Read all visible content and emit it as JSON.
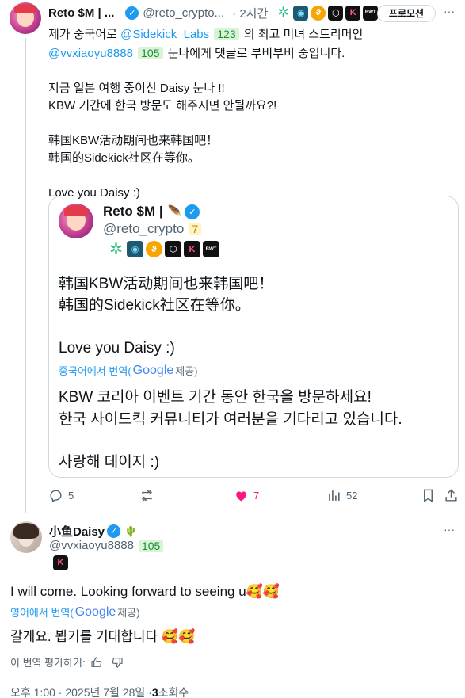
{
  "main_tweet": {
    "display_name": "Reto $M | ...",
    "handle": "@reto_crypto...",
    "time": "· 2시간",
    "promo_button": "프로모션",
    "more": "···",
    "line1_pre": "제가 중국어로 ",
    "mention1": "@Sidekick_Labs",
    "mention1_count": "123",
    "line1_post": " 의 최고 미녀 스트리머인",
    "mention2": "@vvxiaoyu8888",
    "mention2_count": "105",
    "line2_post": " 눈나에게 댓글로 부비부비 중입니다.",
    "line3": "지금 일본 여행 중이신 Daisy 눈나 !!",
    "line4": "KBW 기간에 한국 방문도 해주시면 안될까요?!",
    "line5": "韩国KBW活动期间也来韩国吧！",
    "line6": "韩国的Sidekick社区在等你。",
    "line7": "Love you Daisy :)"
  },
  "quoted_tweet": {
    "display_name": "Reto $M |",
    "handle": "@reto_crypto",
    "handle_count": "7",
    "body1": "韩国KBW活动期间也来韩国吧！",
    "body2": "韩国的Sidekick社区在等你。",
    "body3": "Love you Daisy :)",
    "translate_label": "중국어에서 번역(",
    "google": "Google",
    "provided": " 제공)",
    "trans1": "KBW 코리아 이벤트 기간 동안 한국을 방문하세요!",
    "trans2": "한국 사이드킥 커뮤니티가 여러분을 기다리고 있습니다.",
    "trans3": "사랑해 데이지 :)"
  },
  "actions": {
    "replies": "5",
    "likes": "7",
    "views": "52"
  },
  "reply_tweet": {
    "display_name": "小鱼Daisy",
    "handle": "@vvxiaoyu8888",
    "handle_count": "105",
    "more": "···",
    "body": "I will come. Looking forward to seeing u🥰🥰",
    "translate_label": "영어에서 번역(",
    "google": "Google",
    "provided": " 제공)",
    "trans": "갈게요. 뵙기를 기대합니다 🥰🥰",
    "rate_label": "이 번역 평가하기:",
    "footer_time": "오후 1:00 · 2025년 7월 28일 · ",
    "footer_views": "3",
    "footer_views_label": " 조회수"
  },
  "colors": {
    "accent": "#1d9bf0",
    "like": "#f91880",
    "text": "#0f1419",
    "muted": "#536471"
  }
}
